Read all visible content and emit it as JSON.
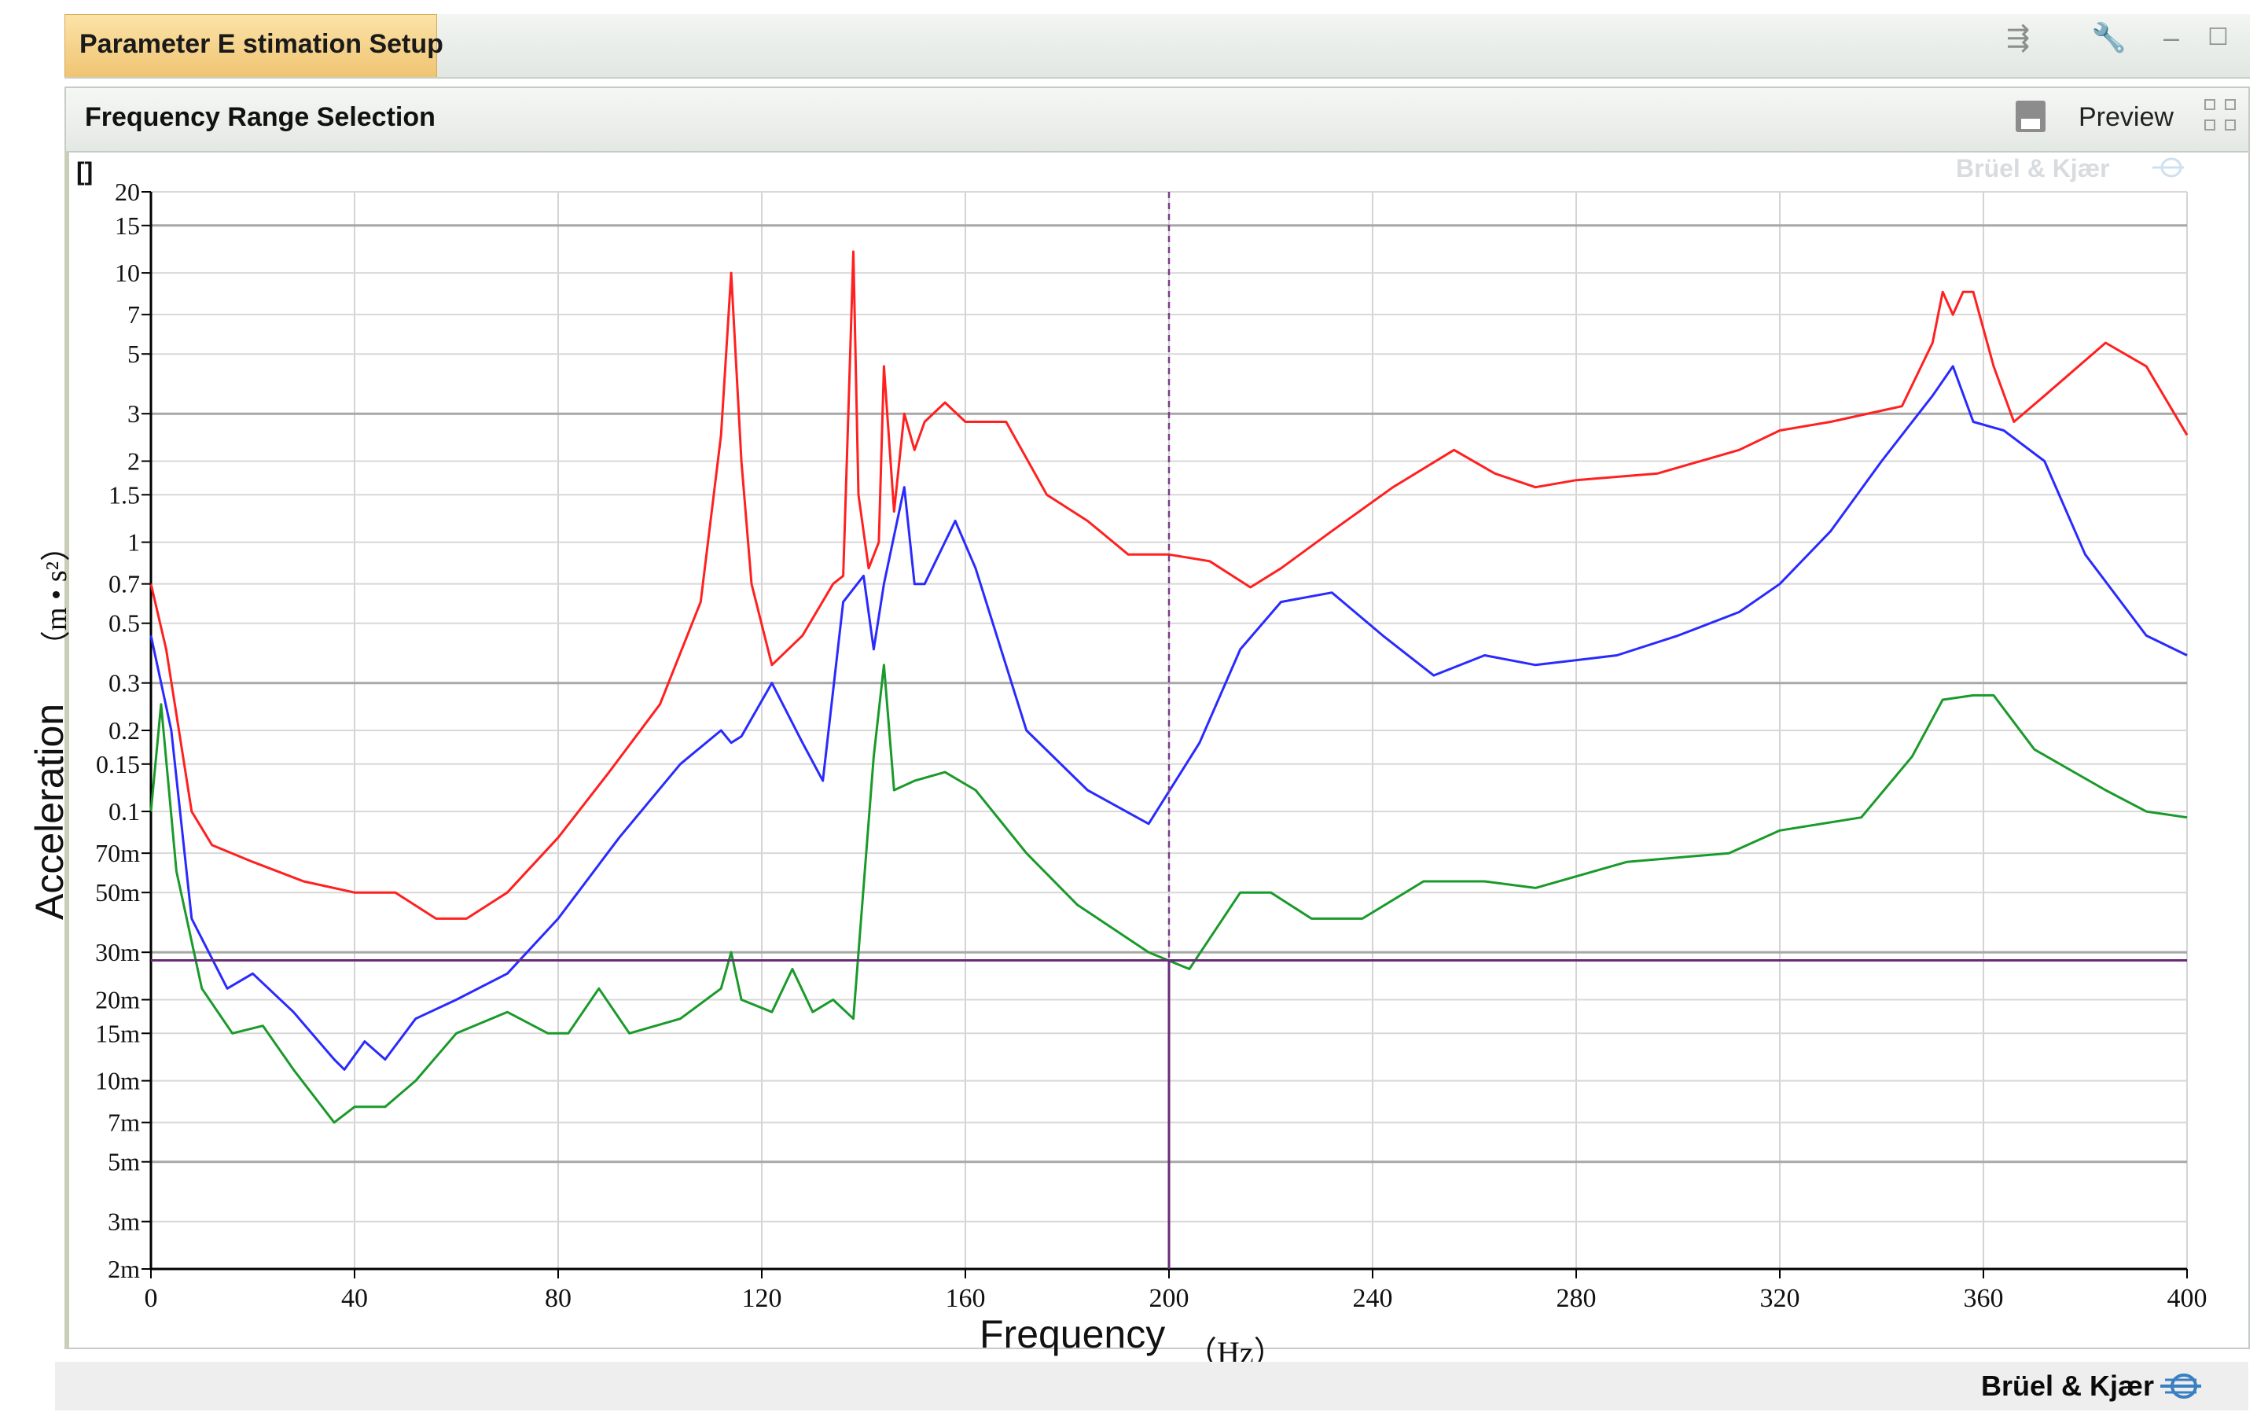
{
  "window": {
    "tab_title": "Parameter E stimation Setup"
  },
  "panel": {
    "title": "Frequency Range Selection",
    "preview_label": "Preview",
    "unit_bracket": "[]"
  },
  "branding": {
    "watermark": "Brüel & Kjær",
    "footer": "Brüel & Kjær"
  },
  "chart_data": {
    "type": "line",
    "xlabel": "Frequency",
    "xunit": "（Hz）",
    "ylabel": "Acceleration",
    "yunit": "（m • s²）",
    "xlim": [
      0,
      400
    ],
    "ylim": [
      0.002,
      20
    ],
    "yscale": "log",
    "x_ticks": [
      0,
      40,
      80,
      120,
      160,
      200,
      240,
      280,
      320,
      360,
      400
    ],
    "x_tick_labels": [
      "0",
      "40",
      "80",
      "120",
      "160",
      "200",
      "240",
      "280",
      "320",
      "360",
      "400"
    ],
    "y_ticks": [
      0.002,
      0.003,
      0.005,
      0.007,
      0.01,
      0.015,
      0.02,
      0.03,
      0.05,
      0.07,
      0.1,
      0.15,
      0.2,
      0.3,
      0.5,
      0.7,
      1,
      1.5,
      2,
      3,
      5,
      7,
      10,
      15,
      20
    ],
    "y_tick_labels": [
      "2m",
      "3m",
      "5m",
      "7m",
      "10m",
      "15m",
      "20m",
      "30m",
      "50m",
      "70m",
      "0.1",
      "0.15",
      "0.2",
      "0.3",
      "0.5",
      "0.7",
      "1",
      "1.5",
      "2",
      "3",
      "5",
      "7",
      "10",
      "15",
      "20"
    ],
    "major_gridlines_y": [
      0.005,
      0.03,
      0.3,
      3,
      15
    ],
    "grid": true,
    "cursor": {
      "x": 200,
      "y": 0.028
    },
    "series": [
      {
        "color": "#ff2020",
        "x": [
          0,
          3,
          8,
          12,
          20,
          30,
          40,
          48,
          56,
          62,
          70,
          80,
          90,
          100,
          108,
          112,
          114,
          116,
          118,
          122,
          128,
          134,
          136,
          137,
          138,
          139,
          141,
          143,
          144,
          146,
          148,
          150,
          152,
          156,
          160,
          168,
          176,
          184,
          192,
          200,
          208,
          216,
          222,
          232,
          244,
          256,
          264,
          272,
          280,
          296,
          312,
          320,
          330,
          344,
          350,
          352,
          354,
          356,
          358,
          362,
          366,
          372,
          384,
          392,
          400
        ],
        "y": [
          0.7,
          0.4,
          0.1,
          0.075,
          0.065,
          0.055,
          0.05,
          0.05,
          0.04,
          0.04,
          0.05,
          0.08,
          0.14,
          0.25,
          0.6,
          2.5,
          10,
          2,
          0.7,
          0.35,
          0.45,
          0.7,
          0.75,
          3,
          12,
          1.5,
          0.8,
          1,
          4.5,
          1.3,
          3,
          2.2,
          2.8,
          3.3,
          2.8,
          2.8,
          1.5,
          1.2,
          0.9,
          0.9,
          0.85,
          0.68,
          0.8,
          1.1,
          1.6,
          2.2,
          1.8,
          1.6,
          1.7,
          1.8,
          2.2,
          2.6,
          2.8,
          3.2,
          5.5,
          8.5,
          7,
          8.5,
          8.5,
          4.5,
          2.8,
          3.5,
          5.5,
          4.5,
          2.5
        ]
      },
      {
        "color": "#2a2aff",
        "x": [
          0,
          4,
          8,
          15,
          20,
          28,
          36,
          38,
          42,
          46,
          52,
          60,
          70,
          80,
          92,
          104,
          112,
          114,
          116,
          122,
          128,
          132,
          136,
          140,
          142,
          144,
          148,
          150,
          152,
          158,
          162,
          172,
          184,
          196,
          206,
          214,
          222,
          232,
          242,
          252,
          262,
          272,
          288,
          300,
          312,
          320,
          330,
          340,
          350,
          354,
          358,
          364,
          372,
          380,
          392,
          400
        ],
        "y": [
          0.45,
          0.2,
          0.04,
          0.022,
          0.025,
          0.018,
          0.012,
          0.011,
          0.014,
          0.012,
          0.017,
          0.02,
          0.025,
          0.04,
          0.08,
          0.15,
          0.2,
          0.18,
          0.19,
          0.3,
          0.18,
          0.13,
          0.6,
          0.75,
          0.4,
          0.7,
          1.6,
          0.7,
          0.7,
          1.2,
          0.8,
          0.2,
          0.12,
          0.09,
          0.18,
          0.4,
          0.6,
          0.65,
          0.45,
          0.32,
          0.38,
          0.35,
          0.38,
          0.45,
          0.55,
          0.7,
          1.1,
          2,
          3.5,
          4.5,
          2.8,
          2.6,
          2,
          0.9,
          0.45,
          0.38
        ]
      },
      {
        "color": "#1a9a2a",
        "x": [
          0,
          2,
          5,
          10,
          16,
          22,
          28,
          36,
          40,
          46,
          52,
          60,
          70,
          78,
          82,
          88,
          94,
          104,
          112,
          114,
          116,
          122,
          126,
          130,
          134,
          138,
          142,
          144,
          146,
          150,
          156,
          162,
          172,
          182,
          196,
          204,
          214,
          220,
          228,
          238,
          250,
          262,
          272,
          290,
          310,
          320,
          336,
          346,
          352,
          358,
          362,
          370,
          384,
          392,
          400
        ],
        "y": [
          0.1,
          0.25,
          0.06,
          0.022,
          0.015,
          0.016,
          0.011,
          0.007,
          0.008,
          0.008,
          0.01,
          0.015,
          0.018,
          0.015,
          0.015,
          0.022,
          0.015,
          0.017,
          0.022,
          0.03,
          0.02,
          0.018,
          0.026,
          0.018,
          0.02,
          0.017,
          0.16,
          0.35,
          0.12,
          0.13,
          0.14,
          0.12,
          0.07,
          0.045,
          0.03,
          0.026,
          0.05,
          0.05,
          0.04,
          0.04,
          0.055,
          0.055,
          0.052,
          0.065,
          0.07,
          0.085,
          0.095,
          0.16,
          0.26,
          0.27,
          0.27,
          0.17,
          0.12,
          0.1,
          0.095
        ]
      }
    ]
  }
}
